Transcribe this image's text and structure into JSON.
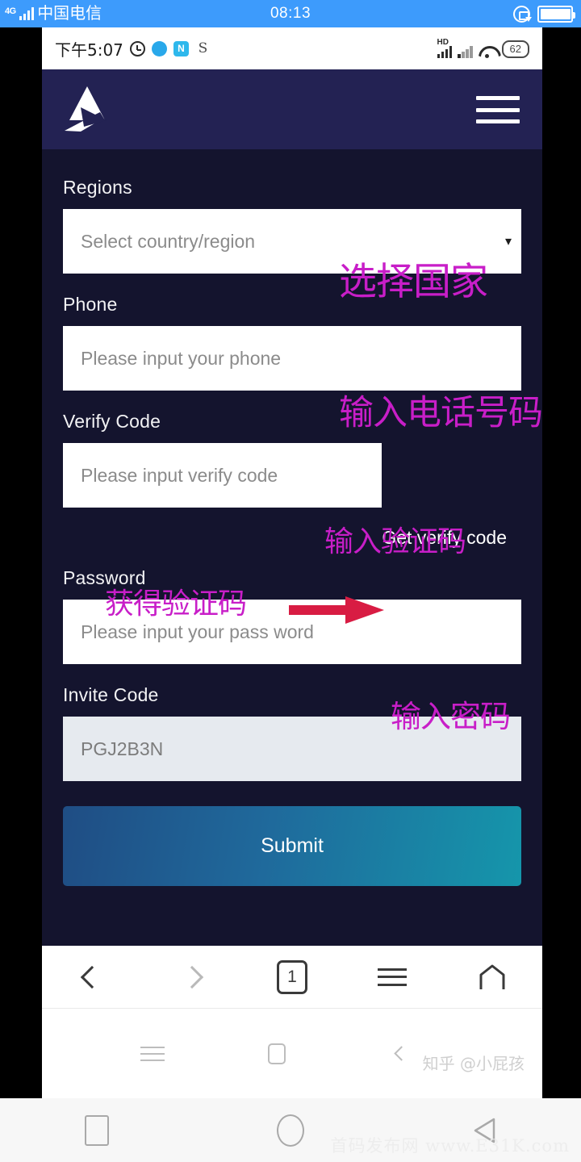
{
  "system_status_bar": {
    "carrier": "中国电信",
    "network": "4G",
    "clock": "08:13",
    "rotation_lock_icon": "rotation-lock-icon",
    "battery_icon": "battery-icon"
  },
  "device_status_bar": {
    "time": "下午5:07",
    "alarm_icon": "alarm-clock-icon",
    "app_icons": [
      "twitter-icon",
      "n-app-icon",
      "s-app-icon"
    ],
    "n_badge": "N",
    "s_badge": "S",
    "hd_label": "HD",
    "wifi_icon": "wifi-icon",
    "battery_percent": "62"
  },
  "app_header": {
    "logo_icon": "app-logo-icon",
    "menu_icon": "hamburger-menu-icon"
  },
  "form": {
    "regions": {
      "label": "Regions",
      "placeholder": "Select country/region",
      "value": "",
      "caret_icon": "chevron-down-icon",
      "annotation": "选择国家"
    },
    "phone": {
      "label": "Phone",
      "placeholder": "Please input your phone",
      "value": "",
      "annotation": "输入电话号码"
    },
    "verify_code": {
      "label": "Verify Code",
      "placeholder": "Please input verify code",
      "value": "",
      "annotation": "输入验证码",
      "get_code_label": "Get verify code",
      "get_code_annotation": "获得验证码"
    },
    "password": {
      "label": "Password",
      "placeholder": "Please input your pass word",
      "value": "",
      "annotation": "输入密码"
    },
    "invite_code": {
      "label": "Invite Code",
      "value": "PGJ2B3N",
      "disabled": true
    },
    "submit_label": "Submit"
  },
  "browser_toolbar": {
    "back_icon": "chevron-left-icon",
    "forward_icon": "chevron-right-icon",
    "tab_count": "1",
    "menu_icon": "hamburger-menu-icon",
    "home_icon": "home-icon"
  },
  "android_softkeys": {
    "menu_icon": "menu-icon",
    "recents_icon": "recents-square-icon",
    "back_icon": "back-chevron-icon"
  },
  "watermarks": {
    "zhihu": "知乎 @小屁孩",
    "bottom": "首码发布网 www.E31K.com"
  },
  "nav_bar": {
    "recents_icon": "recents-square-icon",
    "home_icon": "home-circle-icon",
    "back_icon": "back-triangle-icon"
  },
  "colors": {
    "status_blue": "#3d9bfc",
    "header_navy": "#232253",
    "body_navy": "#14142e",
    "annotation_magenta": "#c81ec8",
    "arrow_red": "#d81c43",
    "submit_gradient_from": "#1f4d84",
    "submit_gradient_to": "#1596ab"
  }
}
